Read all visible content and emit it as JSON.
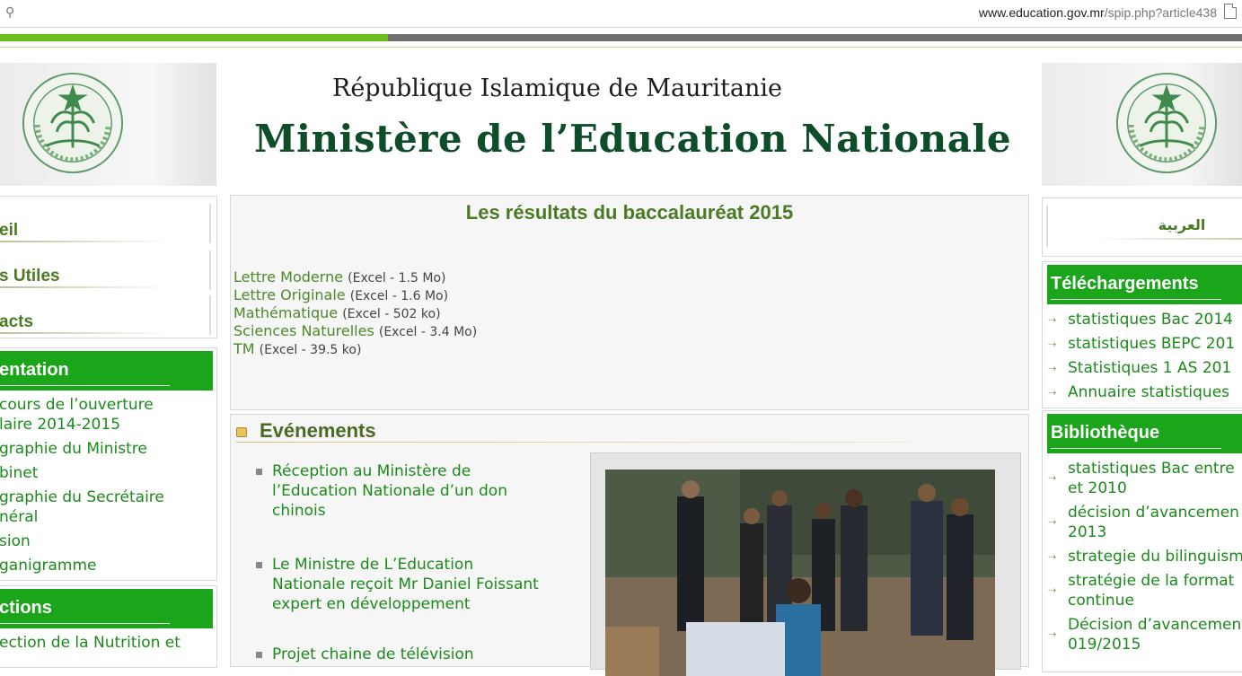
{
  "browser": {
    "url_host": "www.education.gov.mr",
    "url_path": "/spip.php?article438"
  },
  "header": {
    "line1": "République Islamique de Mauritanie",
    "line2": "Ministère de l’Education Nationale"
  },
  "left_nav": [
    "eil",
    "s Utiles",
    "acts"
  ],
  "presentation": {
    "title": "entation",
    "links": [
      "cours de l’ouverture",
      "laire 2014-2015",
      "graphie du Ministre",
      "binet",
      "graphie du Secrétaire",
      "néral",
      "sion",
      "ganigramme"
    ]
  },
  "directions": {
    "title": "ctions",
    "links": [
      "ection de la Nutrition et"
    ]
  },
  "main": {
    "title": "Les résultats du baccalauréat 2015",
    "downloads": [
      {
        "label": "Lettre Moderne",
        "meta": "(Excel - 1.5 Mo)"
      },
      {
        "label": "Lettre Originale",
        "meta": "(Excel - 1.6 Mo)"
      },
      {
        "label": "Mathématique",
        "meta": "(Excel - 502 ko)"
      },
      {
        "label": "Sciences Naturelles",
        "meta": "(Excel - 3.4 Mo)"
      },
      {
        "label": "TM",
        "meta": "(Excel - 39.5 ko)"
      }
    ]
  },
  "events": {
    "title": "Evénements",
    "items": [
      [
        "Réception au Ministère de",
        "l’Education Nationale d’un don",
        "chinois"
      ],
      [
        "Le Ministre de L’Education",
        "Nationale reçoit Mr Daniel Foissant",
        "expert en développement"
      ],
      [
        "Projet chaine de télévision"
      ]
    ]
  },
  "right": {
    "lang_label": "العربية",
    "telechargements": {
      "title": "Téléchargements",
      "links": [
        "statistiques Bac 2014",
        "statistiques BEPC 201",
        "Statistiques 1 AS 201",
        "Annuaire statistiques"
      ]
    },
    "bibliotheque": {
      "title": "Bibliothèque",
      "links": [
        [
          "statistiques Bac entre",
          "et 2010"
        ],
        [
          "décision d’avancemen",
          "2013"
        ],
        [
          "strategie du bilinguism"
        ],
        [
          "stratégie de la format",
          "continue"
        ],
        [
          "Décision d’avancemen",
          "019/2015"
        ]
      ]
    }
  },
  "colors": {
    "green": "#1aa51a",
    "link": "#1b8a1b",
    "title_green": "#4a7a24",
    "top_bar_green": "#6cbf1f",
    "top_bar_grey": "#6f6f6f"
  },
  "icons": [
    "zoom-icon",
    "page-icon",
    "emblem-icon",
    "bullet-icon",
    "arrow-icon"
  ]
}
